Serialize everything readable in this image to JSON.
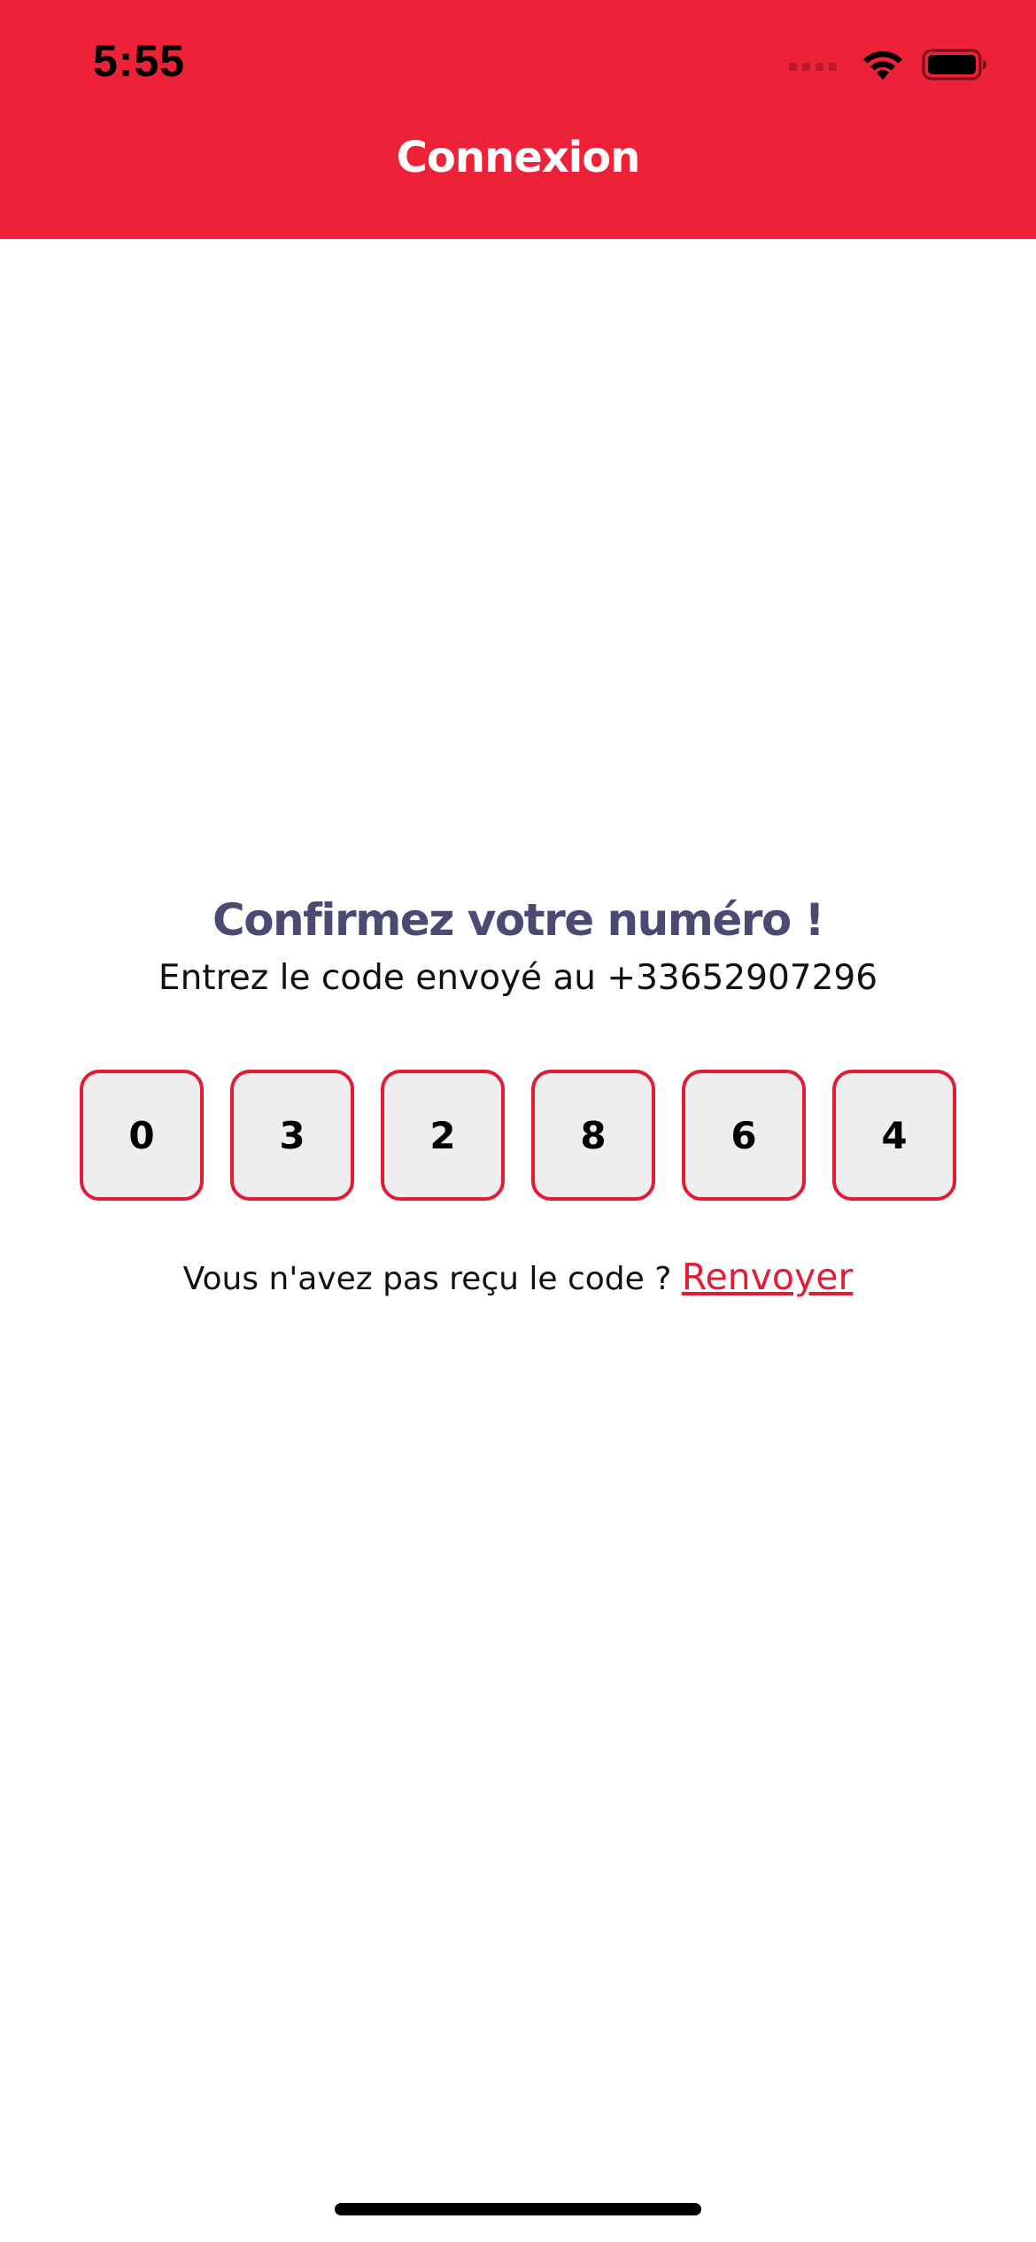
{
  "status_bar": {
    "time": "5:55",
    "icons": [
      "signal-icon",
      "wifi-icon",
      "battery-icon"
    ]
  },
  "header": {
    "title": "Connexion",
    "background_color": "#ED2137"
  },
  "confirm": {
    "title": "Confirmez votre numéro !",
    "subtitle": "Entrez le code envoyé au +33652907296"
  },
  "code": {
    "digits": [
      "0",
      "3",
      "2",
      "8",
      "6",
      "4"
    ]
  },
  "resend": {
    "prompt": "Vous n'avez pas reçu le code ?",
    "link_label": "Renvoyer"
  },
  "colors": {
    "accent": "#ED2137",
    "box_border": "#E11D36",
    "box_fill": "#EEEEEE",
    "title_text": "#4B4A73"
  }
}
